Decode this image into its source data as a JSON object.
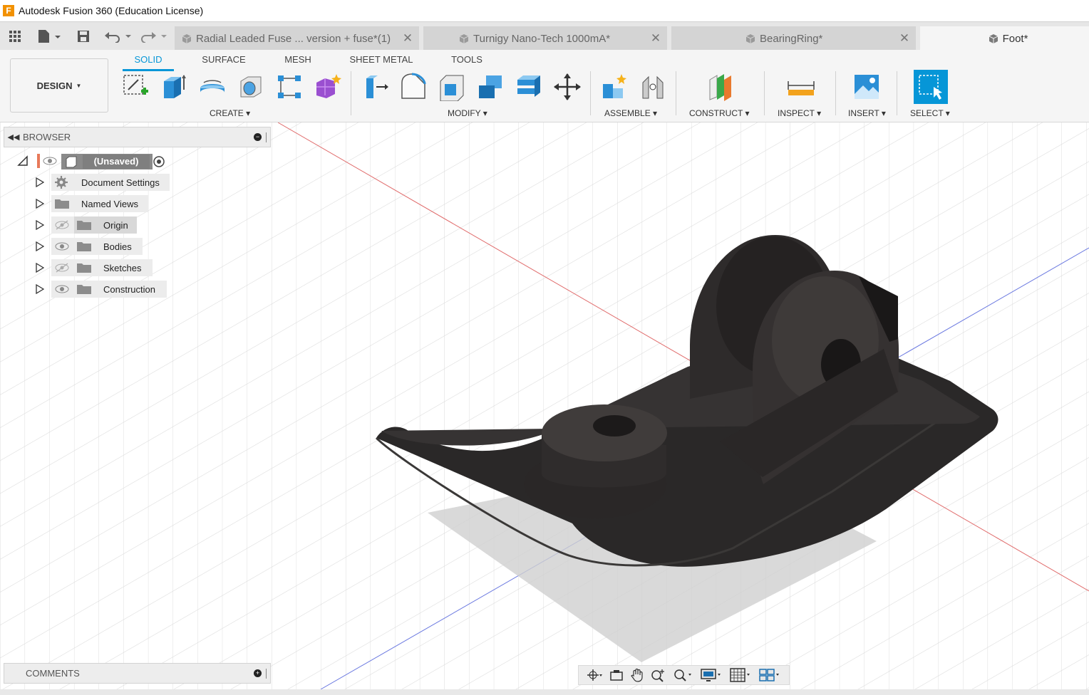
{
  "window": {
    "title": "Autodesk Fusion 360 (Education License)",
    "logo_letter": "F"
  },
  "tabs": [
    {
      "label": "Radial Leaded Fuse ... version + fuse*(1)",
      "close": "✕"
    },
    {
      "label": "Turnigy Nano-Tech 1000mA*",
      "close": "✕"
    },
    {
      "label": "BearingRing*",
      "close": "✕"
    },
    {
      "label": "Foot*"
    }
  ],
  "toolbar": {
    "workspace_label": "DESIGN",
    "workspace_tabs": [
      "SOLID",
      "SURFACE",
      "MESH",
      "SHEET METAL",
      "TOOLS"
    ],
    "active_tab": "SOLID",
    "groups": [
      "CREATE",
      "MODIFY",
      "ASSEMBLE",
      "CONSTRUCT",
      "INSPECT",
      "INSERT",
      "SELECT"
    ],
    "accent_color": "#0696d7"
  },
  "browser": {
    "title": "BROWSER",
    "root": "(Unsaved)",
    "items": [
      {
        "label": "Document Settings",
        "icon": "gear-icon"
      },
      {
        "label": "Named Views",
        "icon": "folder-icon"
      },
      {
        "label": "Origin",
        "icon": "folder-icon",
        "visible": false
      },
      {
        "label": "Bodies",
        "icon": "folder-icon",
        "visible": true
      },
      {
        "label": "Sketches",
        "icon": "folder-icon",
        "visible": false
      },
      {
        "label": "Construction",
        "icon": "folder-icon",
        "visible": true
      }
    ]
  },
  "comments": {
    "title": "COMMENTS"
  },
  "navbar": [
    "orbit-icon",
    "look-at-icon",
    "pan-icon",
    "zoom-icon",
    "fit-icon",
    "display-settings-icon",
    "grid-icon",
    "viewports-icon"
  ]
}
